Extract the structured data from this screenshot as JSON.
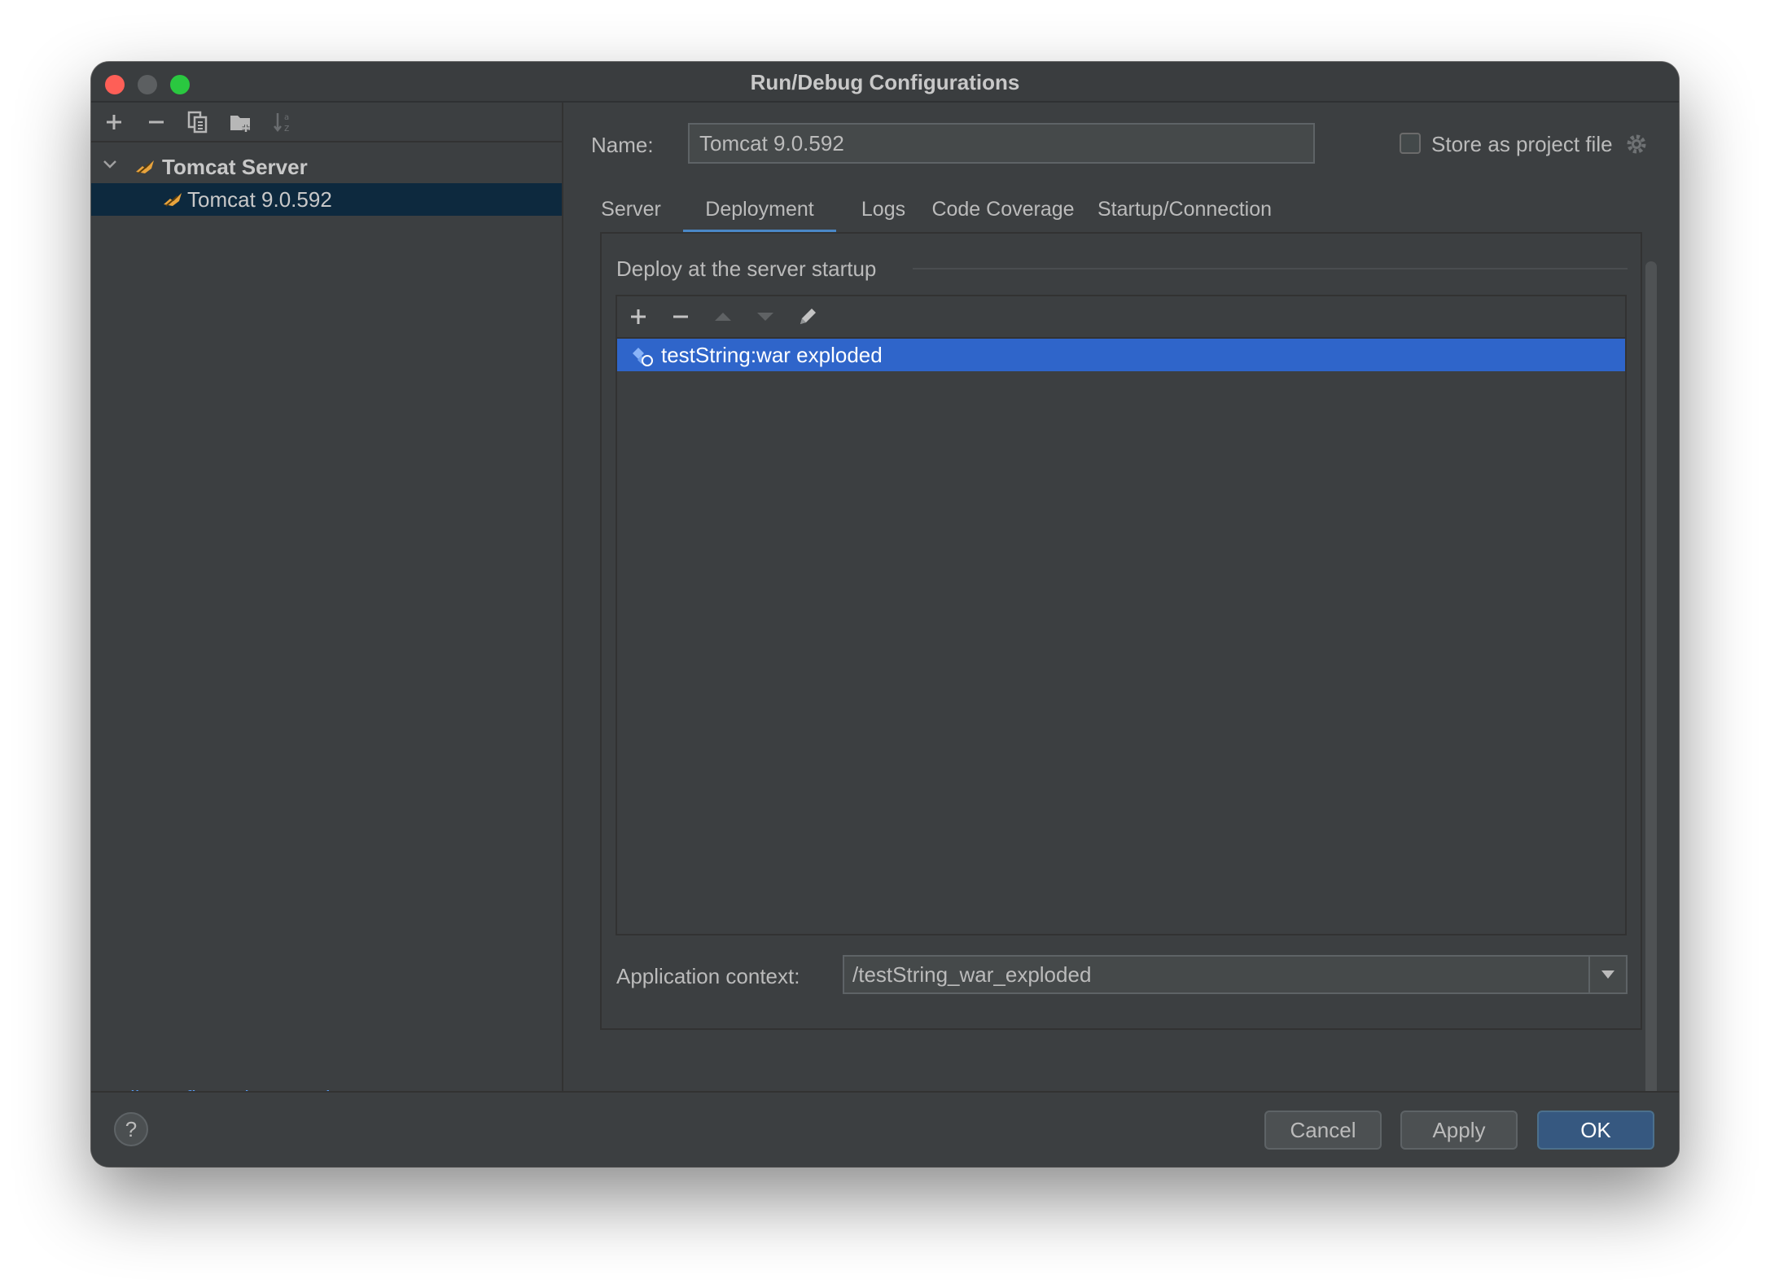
{
  "window": {
    "title": "Run/Debug Configurations"
  },
  "left_toolbar": {
    "add_icon": "plus-icon",
    "remove_icon": "minus-icon",
    "copy_icon": "copy-icon",
    "folder_icon": "new-folder-icon",
    "sort_icon": "sort-alpha-icon"
  },
  "tree": {
    "group_label": "Tomcat Server",
    "items": [
      {
        "label": "Tomcat 9.0.592",
        "selected": true
      }
    ]
  },
  "left_footer": {
    "edit_templates_link": "Edit configuration templates..."
  },
  "config": {
    "name_label": "Name:",
    "name_value": "Tomcat 9.0.592",
    "store_as_project_label": "Store as project file",
    "store_as_project_checked": false
  },
  "tabs": [
    {
      "label": "Server",
      "active": false
    },
    {
      "label": "Deployment",
      "active": true
    },
    {
      "label": "Logs",
      "active": false
    },
    {
      "label": "Code Coverage",
      "active": false
    },
    {
      "label": "Startup/Connection",
      "active": false
    }
  ],
  "deployment": {
    "section_title": "Deploy at the server startup",
    "artifacts": [
      {
        "label": "testString:war exploded",
        "selected": true
      }
    ],
    "app_context_label": "Application context:",
    "app_context_value": "/testString_war_exploded"
  },
  "footer": {
    "help_label": "?",
    "cancel_label": "Cancel",
    "apply_label": "Apply",
    "ok_label": "OK"
  },
  "colors": {
    "accent_tab": "#4a88c7",
    "selected_row": "#2f65ca",
    "link": "#589df6",
    "primary_button": "#365880"
  }
}
